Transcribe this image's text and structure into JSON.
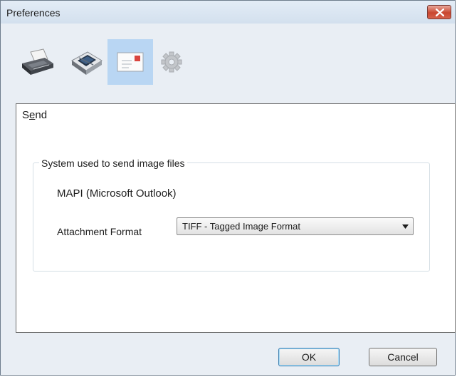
{
  "window": {
    "title": "Preferences"
  },
  "toolbar": {
    "items": [
      {
        "name": "Printer",
        "icon": "printer-icon",
        "selected": false
      },
      {
        "name": "Scanner",
        "icon": "scanner-icon",
        "selected": false
      },
      {
        "name": "Send",
        "icon": "email-icon",
        "selected": true
      },
      {
        "name": "Settings",
        "icon": "gear-icon",
        "selected": false
      }
    ],
    "selected_color": "#b9d6f3"
  },
  "panel": {
    "title_prefix": "S",
    "title_mnemonic": "e",
    "title_suffix": "nd",
    "group": {
      "title": "System used to send image files",
      "system_name": "MAPI (Microsoft Outlook)",
      "attachment_label": "Attachment Format",
      "attachment_format": "TIFF - Tagged Image Format"
    }
  },
  "buttons": {
    "ok": "OK",
    "cancel": "Cancel"
  },
  "colors": {
    "close_button": "#c9462f",
    "window_background": "#e9eef4"
  }
}
